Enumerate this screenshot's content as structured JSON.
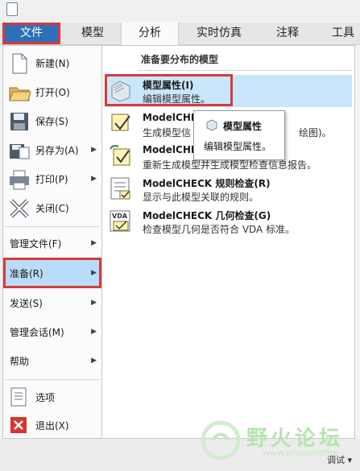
{
  "tabs": [
    "文件",
    "模型",
    "分析",
    "实时仿真",
    "注释",
    "工具"
  ],
  "left_menu": {
    "new": "新建(N)",
    "open": "打开(O)",
    "save": "保存(S)",
    "save_as": "另存为(A)",
    "print": "打印(P)",
    "close": "关闭(C)",
    "manage_files": "管理文件(F)",
    "prepare": "准备(R)",
    "send": "发送(S)",
    "manage_session": "管理会话(M)",
    "help": "帮助",
    "options": "选项",
    "exit": "退出(X)"
  },
  "right_panel": {
    "title": "准备要分布的模型",
    "items": [
      {
        "title": "模型属性(I)",
        "desc": "编辑模型属性。"
      },
      {
        "title": "ModelCHECK",
        "desc": "生成模型信"
      },
      {
        "title": "ModelCHEC",
        "desc": "重新生成模型并生成模型检查信息报告。"
      },
      {
        "title": "ModelCHECK 规则检查(R)",
        "desc": "显示与此模型关联的规则。"
      },
      {
        "title": "ModelCHECK 几何检查(G)",
        "desc": "检查模型几何是否符合 VDA 标准。"
      }
    ],
    "item2_tail": "绘图)。",
    "item1_tail": "绘图)。"
  },
  "tooltip": {
    "title": "模型属性",
    "desc": "编辑模型属性。"
  },
  "watermark": {
    "text": "野火论坛",
    "url": "www.proewildfire"
  },
  "debug_label": "调试 ▾",
  "colors": {
    "file_tab": "#2e6fb9",
    "highlight": "#c9e6fa",
    "callout": "#d63a3a"
  }
}
